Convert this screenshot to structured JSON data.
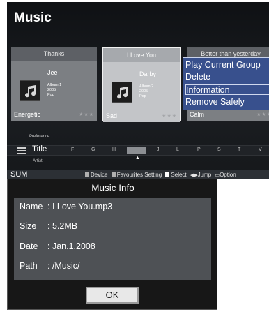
{
  "screen": {
    "title": "Music",
    "cards": [
      {
        "title": "Thanks",
        "artist": "Jee",
        "album": "Album 1",
        "year": "2005",
        "genre": "Pop",
        "mood": "Energetic",
        "stars": "★★★"
      },
      {
        "title": "I Love You",
        "artist": "Darby",
        "album": "Album 2",
        "year": "2005",
        "genre": "Pop",
        "mood": "Sad",
        "stars": "★★★"
      },
      {
        "title": "Better than yesterday",
        "mood": "Calm",
        "stars": "★★★"
      }
    ],
    "popup_menu": {
      "items": [
        "Play Current Group",
        "Delete",
        "Information",
        "Remove Safely"
      ],
      "selected": "Information"
    },
    "sort": {
      "above_label": "Preference",
      "current": "Title",
      "below_label": "Artist",
      "letters": [
        "F",
        "G",
        "H",
        "J",
        "L",
        "P",
        "S",
        "T",
        "V"
      ]
    },
    "bottom_bar": {
      "device": "SUM",
      "hints": {
        "device": "Device",
        "favourites": "Favourites Setting",
        "select": "Select",
        "jump": "Jump",
        "option": "Option"
      }
    }
  },
  "dialog": {
    "title": "Music Info",
    "fields": [
      {
        "label": "Name",
        "value": ": I Love You.mp3"
      },
      {
        "label": "Size",
        "value": ": 5.2MB"
      },
      {
        "label": "Date",
        "value": ": Jan.1.2008"
      },
      {
        "label": "Path",
        "value": ": /Music/"
      }
    ],
    "ok_label": "OK"
  }
}
